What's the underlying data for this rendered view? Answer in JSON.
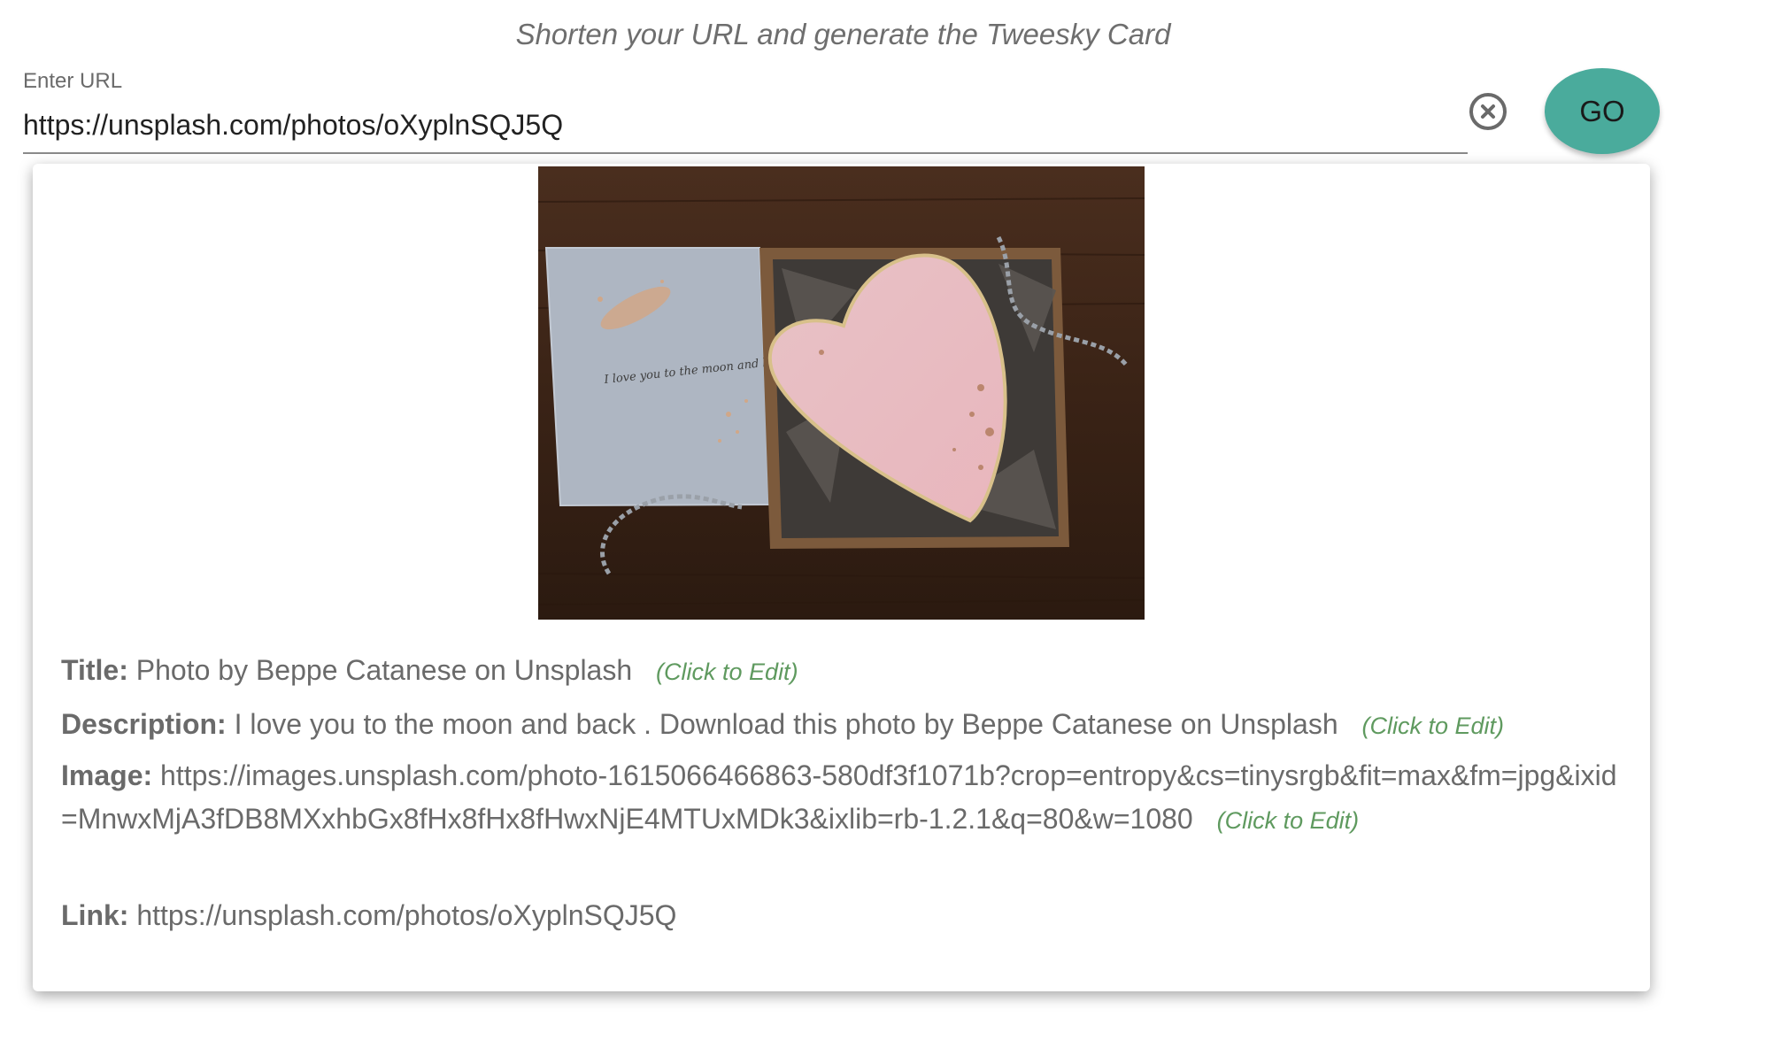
{
  "header": {
    "subtitle": "Shorten your URL and generate the Tweesky Card"
  },
  "url_input": {
    "label": "Enter URL",
    "value": "https://unsplash.com/photos/oXyplnSQJ5Q"
  },
  "buttons": {
    "go": "GO"
  },
  "preview": {
    "title_label": "Title:",
    "title_value": "Photo by Beppe Catanese on Unsplash",
    "description_label": "Description:",
    "description_value": "I love you to the moon and back . Download this photo by Beppe Catanese on Unsplash",
    "image_label": "Image:",
    "image_value": "https://images.unsplash.com/photo-1615066466863-580df3f1071b?crop=entropy&cs=tinysrgb&fit=max&fm=jpg&ixid=MnwxMjA3fDB8MXxhbGx8fHx8fHx8fHwxNjE4MTUxMDk3&ixlib=rb-1.2.1&q=80&w=1080",
    "link_label": "Link:",
    "link_value": "https://unsplash.com/photos/oXyplnSQJ5Q",
    "edit_hint": "(Click to Edit)",
    "photo_note_text": "I love you to the moon and back"
  },
  "colors": {
    "accent": "#4aab9c",
    "edit_hint": "#5f9a5f"
  },
  "icons": {
    "clear": "close-circle-icon"
  }
}
